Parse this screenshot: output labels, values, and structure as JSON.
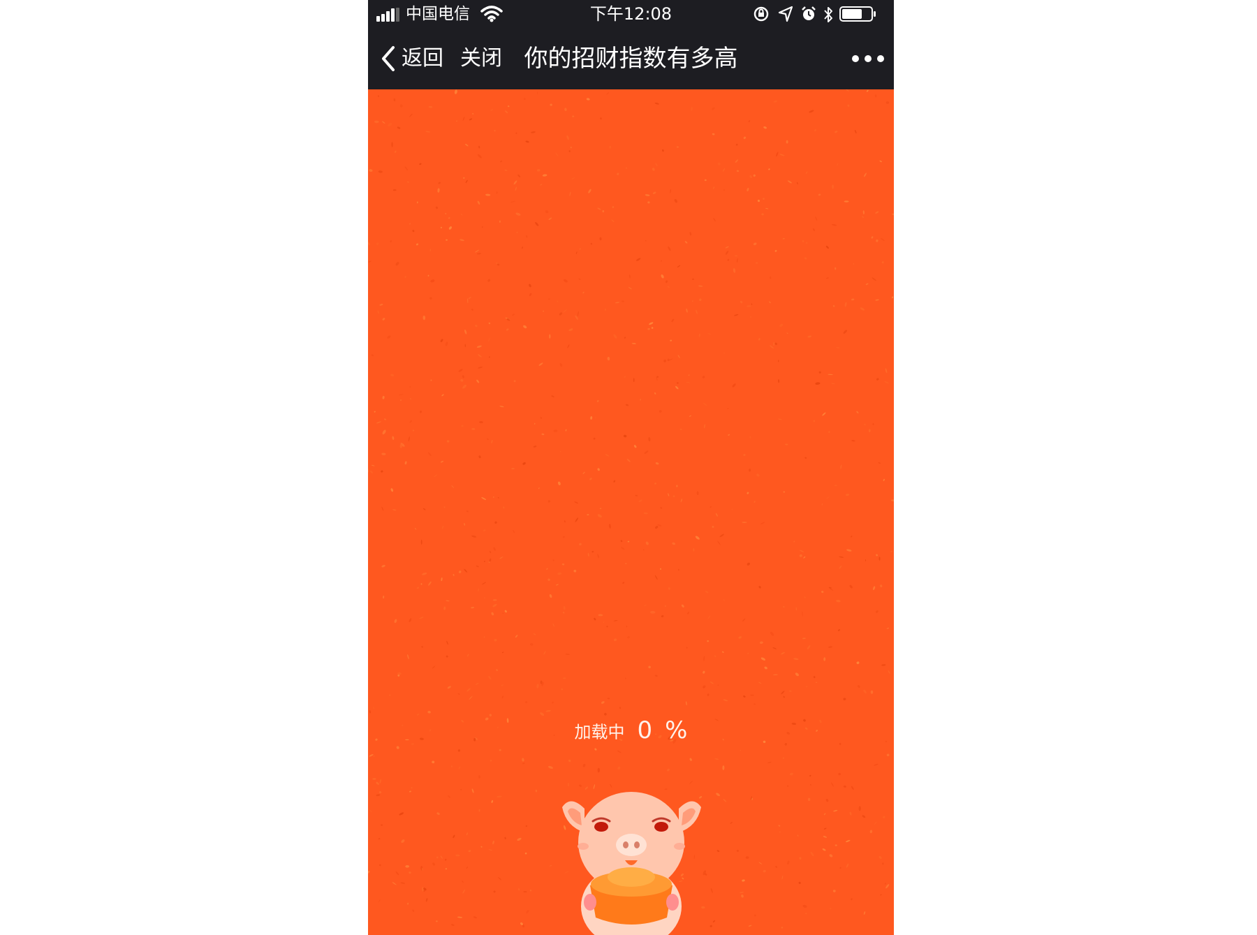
{
  "status_bar": {
    "carrier": "中国电信",
    "time": "下午12:08",
    "battery_level": 0.7,
    "icons": [
      "signal-icon",
      "wifi-icon",
      "rotation-lock-icon",
      "location-icon",
      "alarm-icon",
      "bluetooth-icon",
      "battery-icon"
    ]
  },
  "nav": {
    "back_label": "返回",
    "close_label": "关闭",
    "title": "你的招财指数有多高",
    "more_icon": "more-dots-icon"
  },
  "loading": {
    "label": "加载中",
    "value": "0",
    "unit": "%",
    "progress": 0
  },
  "colors": {
    "background": "#ff581f",
    "nav_background": "#1d1d22",
    "text_light": "#ffffff",
    "pig_skin": "#ffc6ad",
    "gold_ingot": "#ff7a1a"
  }
}
